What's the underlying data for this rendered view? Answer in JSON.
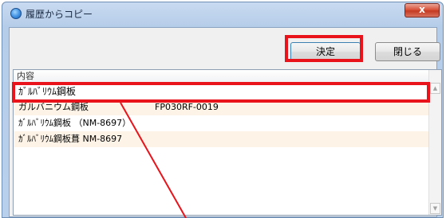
{
  "window": {
    "title": "履歴からコピー",
    "close_glyph": "x"
  },
  "toolbar": {
    "ok_label": "決定",
    "close_label": "閉じる"
  },
  "list": {
    "column_header": "内容",
    "rows": [
      {
        "content": "ｶﾞﾙﾊﾞﾘｳﾑ鋼板",
        "code": ""
      },
      {
        "content": "ガルバニウム鋼板",
        "code": "FP030RF-0019"
      },
      {
        "content": "ｶﾞﾙﾊﾞﾘｳﾑ鋼板 （NM-8697）",
        "code": ""
      },
      {
        "content": "ｶﾞﾙﾊﾞﾘｳﾑ鋼板葺 NM-8697",
        "code": ""
      }
    ]
  },
  "scrollbar": {
    "up_glyph": "▲",
    "down_glyph": "▼"
  },
  "annotation": {
    "color": "#e8131b"
  }
}
